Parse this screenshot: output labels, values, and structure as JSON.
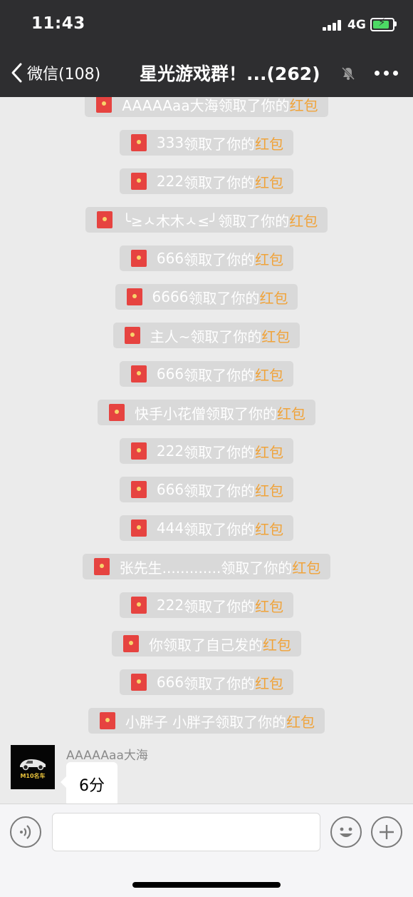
{
  "status_bar": {
    "time": "11:43",
    "network": "4G",
    "battery_level": 0.85,
    "battery_color": "#4cd964"
  },
  "nav": {
    "back_label": "微信(108)",
    "title": "星光游戏群！...(262)",
    "mute_icon": "bell-muted-icon",
    "more_icon": "more-dots-icon"
  },
  "system_messages": [
    {
      "name": "AAAAAaa大海",
      "action": "领取了你的",
      "highlight": "红包"
    },
    {
      "name": "333",
      "action": "领取了你的",
      "highlight": "红包"
    },
    {
      "name": "222",
      "action": "领取了你的",
      "highlight": "红包"
    },
    {
      "name": "╰≥ㅅ木木ㅅ≤╯ ",
      "action": "领取了你的",
      "highlight": "红包"
    },
    {
      "name": "666",
      "action": "领取了你的",
      "highlight": "红包"
    },
    {
      "name": "6666",
      "action": "领取了你的",
      "highlight": "红包"
    },
    {
      "name": "主人~",
      "action": "领取了你的",
      "highlight": "红包"
    },
    {
      "name": "666",
      "action": "领取了你的",
      "highlight": "红包"
    },
    {
      "name": "快手小花僧",
      "action": "领取了你的",
      "highlight": "红包"
    },
    {
      "name": "222",
      "action": "领取了你的",
      "highlight": "红包"
    },
    {
      "name": "666",
      "action": "领取了你的",
      "highlight": "红包"
    },
    {
      "name": "444",
      "action": "领取了你的",
      "highlight": "红包"
    },
    {
      "name": "张先生.............",
      "action": "领取了你的",
      "highlight": "红包"
    },
    {
      "name": "222",
      "action": "领取了你的",
      "highlight": "红包"
    },
    {
      "name": "你",
      "action": "领取了自己发的",
      "highlight": "红包"
    },
    {
      "name": "666",
      "action": "领取了你的",
      "highlight": "红包"
    },
    {
      "name": "小胖子 小胖子",
      "action": "领取了你的",
      "highlight": "红包"
    }
  ],
  "last_message": {
    "sender": "AAAAAaa大海",
    "avatar_text": "M10名车",
    "text": "6分"
  },
  "input_bar": {
    "voice_icon": "voice-icon",
    "emoji_icon": "emoji-icon",
    "plus_icon": "plus-icon",
    "input_value": ""
  },
  "colors": {
    "bar_bg": "#2e2e30",
    "chat_bg": "#ebebeb",
    "pill_bg": "#d9d9d9",
    "red_packet": "#e64340",
    "highlight": "#f0a33a"
  }
}
